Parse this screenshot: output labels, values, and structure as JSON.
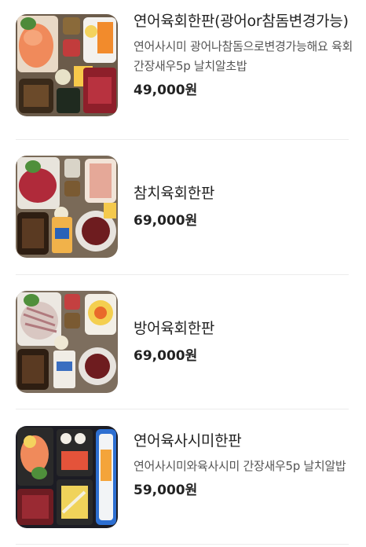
{
  "menu": {
    "items": [
      {
        "name": "연어육회한판(광어or참돔변경가능)",
        "description": "연어사시미 광어나참돔으로변경가능해요 육회 간장새우5p 날치알초밥",
        "price": "49,000원",
        "image_icon": "food-platter-photo"
      },
      {
        "name": "참치육회한판",
        "description": "",
        "price": "69,000원",
        "image_icon": "food-platter-photo"
      },
      {
        "name": "방어육회한판",
        "description": "",
        "price": "69,000원",
        "image_icon": "food-platter-photo"
      },
      {
        "name": "연어육사시미한판",
        "description": "연어사시미와육사시미 간장새우5p 날치알밥",
        "price": "59,000원",
        "image_icon": "food-platter-photo"
      }
    ]
  },
  "colors": {
    "text_primary": "#222222",
    "text_secondary": "#555555",
    "divider": "#ececec"
  }
}
